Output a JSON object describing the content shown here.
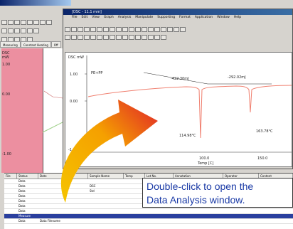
{
  "back_window": {
    "title": "",
    "tabs": [
      "Measuring",
      "Constant Heating",
      "Off"
    ],
    "y_ticks": [
      "DSC mW",
      "1.00",
      "0.00",
      "-1.00"
    ]
  },
  "front_window": {
    "title": "[DSC - 11.1 mm]",
    "menu": [
      "File",
      "Edit",
      "View",
      "Graph",
      "Analysis",
      "Manipulate",
      "Supporting",
      "Format",
      "Application",
      "Window",
      "Help"
    ],
    "ylabel": "DSC mW",
    "y_ticks": [
      "1.00",
      "0.00",
      "-1.00"
    ],
    "sample_label": "PE+PP",
    "annotations": {
      "left_enthalpy": "-422.30mJ",
      "right_enthalpy": "-292.02mJ",
      "left_peak": "114.98°C",
      "right_peak": "163.78°C"
    },
    "x_ticks": [
      "100.0",
      "150.0"
    ],
    "xlabel": "Temp [C]"
  },
  "table": {
    "headers": [
      "File",
      "Status",
      "Date",
      "Sample Name",
      "Temp",
      "Lot No.",
      "Annotation",
      "Operator",
      "Content"
    ],
    "rows": [
      [
        "",
        "Data",
        "",
        "",
        "",
        "",
        "",
        "",
        ""
      ],
      [
        "",
        "Data",
        "",
        "DSC",
        "",
        "",
        "",
        "",
        ""
      ],
      [
        "",
        "Data",
        "",
        "Std",
        "",
        "",
        "",
        "",
        ""
      ],
      [
        "",
        "Data",
        "",
        "",
        "",
        "",
        "",
        "",
        ""
      ],
      [
        "",
        "Data",
        "",
        "",
        "",
        "",
        "",
        "",
        ""
      ],
      [
        "",
        "Data",
        "",
        "",
        "",
        "",
        "",
        "",
        ""
      ],
      [
        "",
        "Data",
        "",
        "",
        "",
        "",
        "",
        "",
        ""
      ],
      [
        "",
        "Measure",
        "",
        "",
        "",
        "",
        "",
        "",
        ""
      ],
      [
        "",
        "Data",
        "Data Filename",
        "",
        "",
        "",
        "",
        "",
        ""
      ]
    ]
  },
  "callout": {
    "line1": "Double-click to open the",
    "line2": "Data Analysis window."
  },
  "colors": {
    "curve": "#f08070",
    "arrow_start": "#f5c400",
    "arrow_end": "#e0202a",
    "callout_text": "#1a3aa6"
  }
}
